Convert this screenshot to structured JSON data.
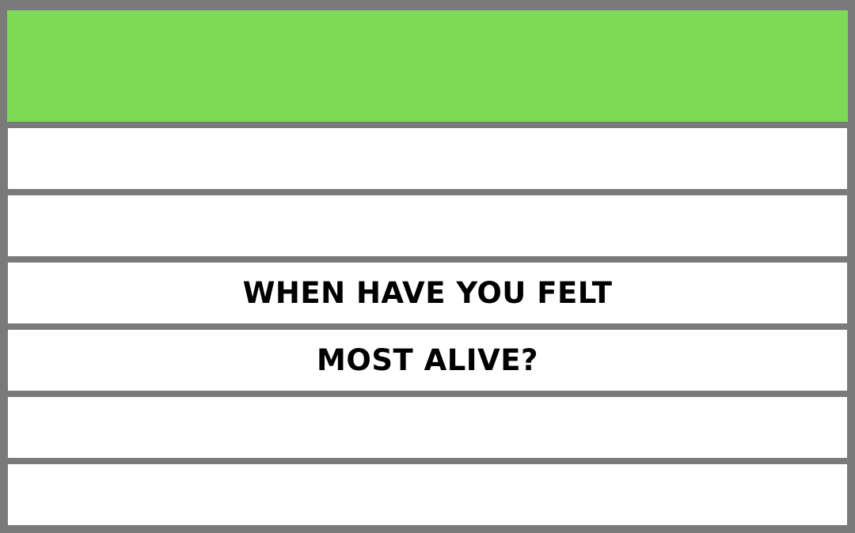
{
  "colors": {
    "header_fill": "#7ed957",
    "frame": "#7a7a7a",
    "row_fill": "#ffffff",
    "text": "#000000"
  },
  "question": {
    "line_1": "WHEN HAVE YOU FELT",
    "line_2": "MOST ALIVE?"
  }
}
